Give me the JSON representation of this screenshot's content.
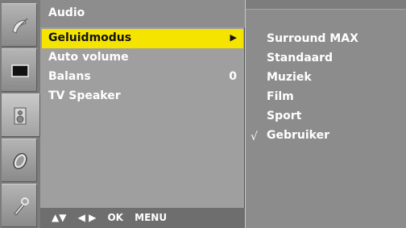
{
  "menu": {
    "title": "Audio",
    "items": [
      {
        "label": "Geluidmodus",
        "value": "",
        "arrow": "▶",
        "highlighted": true
      },
      {
        "label": "Auto volume",
        "value": ""
      },
      {
        "label": "Balans",
        "value": "0"
      },
      {
        "label": "TV Speaker",
        "value": ""
      }
    ]
  },
  "navigation": {
    "up_down": "▲▼",
    "left_right": "◀ ▶",
    "ok": "OK",
    "menu": "MENU"
  },
  "submenu": {
    "options": [
      {
        "label": "Surround MAX",
        "checked": false
      },
      {
        "label": "Standaard",
        "checked": false
      },
      {
        "label": "Muziek",
        "checked": false
      },
      {
        "label": "Film",
        "checked": false
      },
      {
        "label": "Sport",
        "checked": false
      },
      {
        "label": "Gebruiker",
        "checked": true
      }
    ],
    "check_mark": "√"
  },
  "sidebar": {
    "icons": [
      "satellite-dish-icon",
      "screen-icon",
      "speaker-icon",
      "clock-icon",
      "wrench-icon"
    ],
    "selected_icon": "speaker-icon"
  },
  "colors": {
    "highlight": "#f5e400"
  }
}
